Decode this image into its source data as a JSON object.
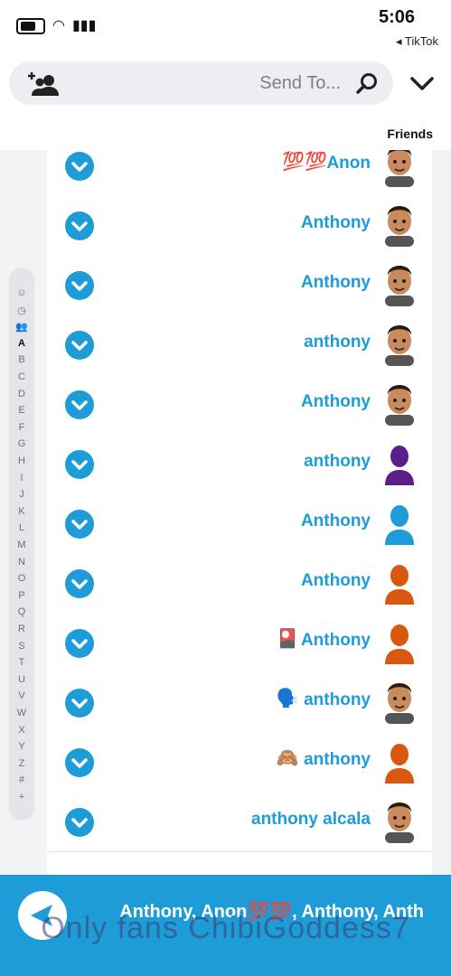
{
  "status": {
    "time": "5:06",
    "back_label": "◂ TikTok"
  },
  "search": {
    "placeholder": "Send To..."
  },
  "section": {
    "title": "Friends"
  },
  "rows": [
    {
      "name": "Anon",
      "emoji": "💯💯",
      "avatar": "bitmoji"
    },
    {
      "name": "Anthony",
      "emoji": "",
      "avatar": "bitmoji"
    },
    {
      "name": "Anthony",
      "emoji": "",
      "avatar": "bitmoji"
    },
    {
      "name": "anthony",
      "emoji": "",
      "avatar": "bitmoji"
    },
    {
      "name": "Anthony",
      "emoji": "",
      "avatar": "bitmoji"
    },
    {
      "name": "anthony",
      "emoji": "",
      "avatar": "silhouette-purple"
    },
    {
      "name": "Anthony",
      "emoji": "",
      "avatar": "silhouette-blue"
    },
    {
      "name": "Anthony",
      "emoji": "",
      "avatar": "silhouette-orange"
    },
    {
      "name": "Anthony",
      "emoji": "🎴",
      "avatar": "silhouette-orange"
    },
    {
      "name": "anthony",
      "emoji": "🗣️",
      "avatar": "bitmoji"
    },
    {
      "name": "anthony",
      "emoji": "🙈",
      "avatar": "silhouette-orange"
    },
    {
      "name": "anthony alcala",
      "emoji": "",
      "avatar": "bitmoji"
    }
  ],
  "alpha_index": [
    "☺",
    "◷",
    "👥",
    "A",
    "B",
    "C",
    "D",
    "E",
    "F",
    "G",
    "H",
    "I",
    "J",
    "K",
    "L",
    "M",
    "N",
    "O",
    "P",
    "Q",
    "R",
    "S",
    "T",
    "U",
    "V",
    "W",
    "X",
    "Y",
    "Z",
    "#",
    "+"
  ],
  "send_bar": {
    "names": "Anthony, Anon💯💯, Anthony, Anth"
  },
  "watermark": "Only fans ChibiGoddess7",
  "colors": {
    "accent": "#1e9cd7"
  }
}
